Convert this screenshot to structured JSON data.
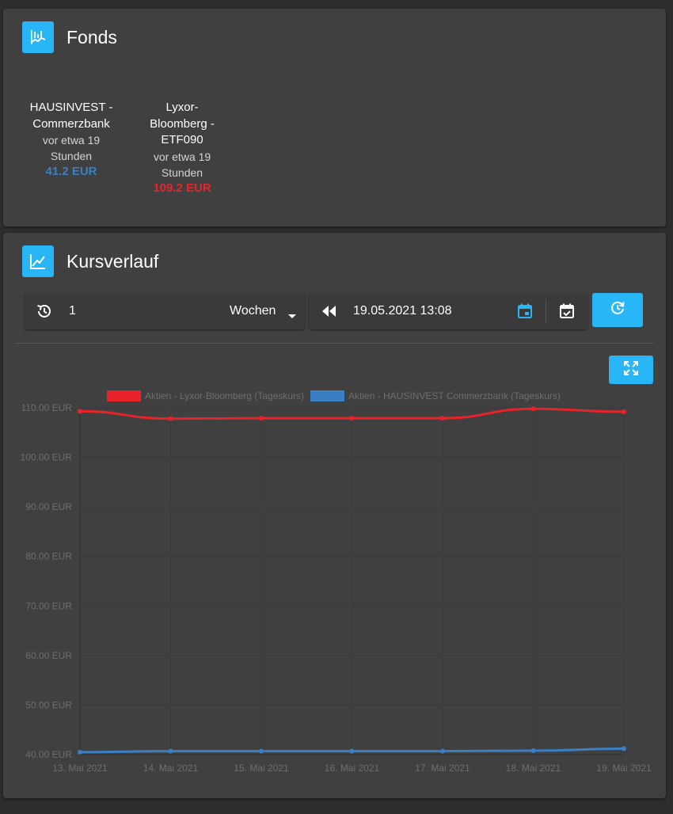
{
  "fonds": {
    "title": "Fonds",
    "icon": "stock-chart-icon",
    "items": [
      {
        "name_lines": [
          "HAUSINVEST -",
          "Commerzbank"
        ],
        "time_lines": [
          "vor etwa 19",
          "Stunden"
        ],
        "value": "41.2 EUR",
        "color": "#3a7fc4"
      },
      {
        "name_lines": [
          "Lyxor-",
          "Bloomberg -",
          "ETF090"
        ],
        "time_lines": [
          "vor etwa 19",
          "Stunden"
        ],
        "value": "109.2 EUR",
        "color": "#e8232a"
      }
    ]
  },
  "kursverlauf": {
    "title": "Kursverlauf",
    "icon": "line-chart-icon",
    "controls": {
      "period_value": "1",
      "period_unit": "Wochen",
      "date_value": "19.05.2021 13:08",
      "accent": "#29b6f6"
    }
  },
  "chart_data": {
    "type": "line",
    "categories": [
      "13. Mai 2021",
      "14. Mai 2021",
      "15. Mai 2021",
      "16. Mai 2021",
      "17. Mai 2021",
      "18. Mai 2021",
      "19. Mai 2021"
    ],
    "series": [
      {
        "name": "Aktien - Lyxor-Bloomberg (Tageskurs)",
        "color": "#e8232a",
        "values": [
          109.3,
          107.8,
          107.9,
          107.9,
          107.9,
          109.8,
          109.2
        ]
      },
      {
        "name": "Aktien - HAUSINVEST Commerzbank (Tageskurs)",
        "color": "#3a7fc4",
        "values": [
          40.5,
          40.7,
          40.7,
          40.7,
          40.7,
          40.8,
          41.2
        ]
      }
    ],
    "y_ticks": [
      "110.00 EUR",
      "100.00 EUR",
      "90.00 EUR",
      "80.00 EUR",
      "70.00 EUR",
      "60.00 EUR",
      "50.00 EUR",
      "40.00 EUR"
    ],
    "ylim": [
      40,
      110
    ],
    "grid": true,
    "legend_position": "top"
  }
}
